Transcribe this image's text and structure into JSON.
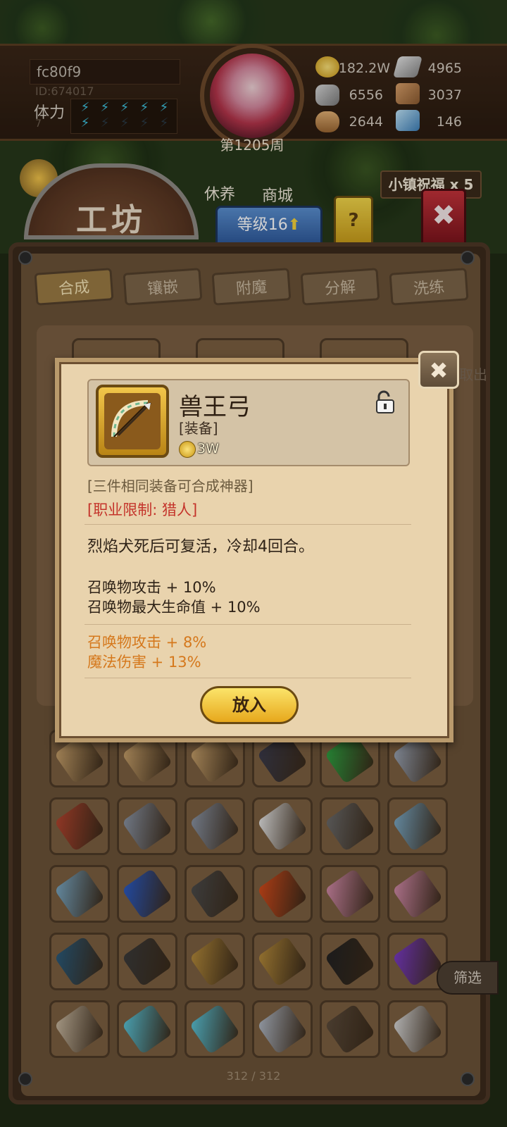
{
  "player": {
    "name": "fc80f9",
    "id_label": "ID:674017",
    "stamina_label": "体力",
    "stamina_sub": "7",
    "week_label": "第1205周"
  },
  "resources": [
    {
      "icon": "gold-coin-icon",
      "value": "182.2W"
    },
    {
      "icon": "iron-ingot-icon",
      "value": "4965"
    },
    {
      "icon": "stone-icon",
      "value": "6556"
    },
    {
      "icon": "leather-icon",
      "value": "3037"
    },
    {
      "icon": "wood-log-icon",
      "value": "2644"
    },
    {
      "icon": "crystal-icon",
      "value": "146"
    }
  ],
  "nav": {
    "rest_label": "休养",
    "shop_label": "商城",
    "blessing_label": "小镇祝福 x 5",
    "workshop_title": "工坊",
    "level_label": "等级16",
    "help_label": "?"
  },
  "tabs": [
    {
      "label": "合成",
      "active": true
    },
    {
      "label": "镶嵌",
      "active": false
    },
    {
      "label": "附魔",
      "active": false
    },
    {
      "label": "分解",
      "active": false
    },
    {
      "label": "洗练",
      "active": false
    }
  ],
  "behind_button_label": "取出",
  "filter_label": "筛选",
  "page_count": "312 / 312",
  "item_popup": {
    "name": "兽王弓",
    "type": "[装备]",
    "price": "3W",
    "synth_note": "[三件相同装备可合成神器]",
    "class_restriction": "[职业限制: 猎人]",
    "effect": "烈焰犬死后可复活，冷却4回合。",
    "stats": [
      "召唤物攻击 + 10%",
      "召唤物最大生命值 + 10%"
    ],
    "bonus_stats": [
      "召唤物攻击 + 8%",
      "魔法伤害 + 13%"
    ],
    "put_in_label": "放入"
  },
  "inventory_rows": [
    [
      "bow-icon",
      "bow-icon",
      "bow-icon",
      "dark-bow-icon",
      "green-orb-icon",
      "feather-blade-icon"
    ],
    [
      "red-armor-icon",
      "rifle-icon",
      "rifle-icon",
      "white-fur-icon",
      "axe-icon",
      "spear-icon"
    ],
    [
      "spear-icon",
      "blue-staff-icon",
      "dagger-icon",
      "fire-bow-icon",
      "pink-chest-icon",
      "pink-chest-icon"
    ],
    [
      "tome-icon",
      "crossbow-icon",
      "rapier-icon",
      "rapier-icon",
      "black-staff-icon",
      "purple-blade-icon"
    ],
    [
      "drill-lance-icon",
      "spirit-bow-icon",
      "spirit-bow-icon",
      "long-sword-icon",
      "shield-icon",
      "lantern-icon"
    ]
  ],
  "colors": {
    "accent_gold": "#f2c64a",
    "restriction_red": "#c4332a",
    "bonus_orange": "#d5781c"
  }
}
